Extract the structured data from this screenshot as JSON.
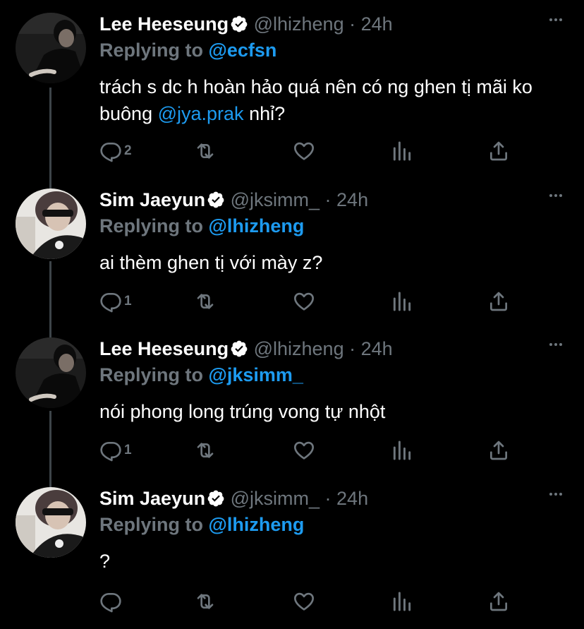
{
  "colors": {
    "background": "#000000",
    "muted": "#6e767d",
    "accent": "#1d9bf0",
    "thread_line": "#3d4449"
  },
  "icons": [
    "verified-badge-icon",
    "more-icon",
    "reply-icon",
    "retweet-icon",
    "like-icon",
    "analytics-icon",
    "share-icon"
  ],
  "tweets": [
    {
      "name": "Lee Heeseung",
      "handle": "@lhizheng",
      "dot": "·",
      "time": "24h",
      "replying_prefix": "Replying to",
      "replying_to": "@ecfsn",
      "text_before": "trách s dc h hoàn hảo quá nên có ng ghen tị mãi ko buông",
      "mention": "@jya.prak",
      "text_after": "nhỉ?",
      "reply_count": "2"
    },
    {
      "name": "Sim Jaeyun",
      "handle": "@jksimm_",
      "dot": "·",
      "time": "24h",
      "replying_prefix": "Replying to",
      "replying_to": "@lhizheng",
      "text": "ai thèm ghen tị với mày z?",
      "reply_count": "1"
    },
    {
      "name": "Lee Heeseung",
      "handle": "@lhizheng",
      "dot": "·",
      "time": "24h",
      "replying_prefix": "Replying to",
      "replying_to": "@jksimm_",
      "text": "nói phong long trúng vong tự nhột",
      "reply_count": "1"
    },
    {
      "name": "Sim Jaeyun",
      "handle": "@jksimm_",
      "dot": "·",
      "time": "24h",
      "replying_prefix": "Replying to",
      "replying_to": "@lhizheng",
      "text": "?",
      "reply_count": ""
    }
  ]
}
